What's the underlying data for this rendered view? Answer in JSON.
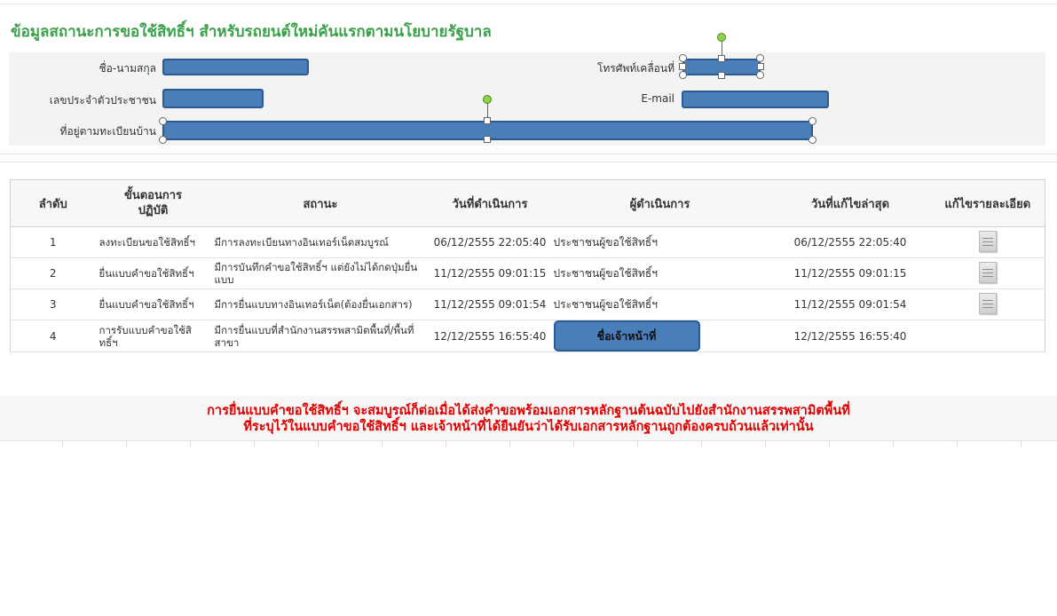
{
  "form": {
    "title": "ข้อมูลสถานะการขอใช้สิทธิ์ฯ สำหรับรถยนต์ใหม่คันแรกตามนโยบายรัฐบาล",
    "label_name": "ชื่อ-นามสกุล",
    "label_id": "เลขประจำตัวประชาชน",
    "label_address": "ที่อยู่ตามทะเบียนบ้าน",
    "label_mobile": "โทรศัพท์เคลื่อนที่",
    "label_email": "E-mail"
  },
  "table": {
    "headers": {
      "no": "ลำดับ",
      "step": "ขั้นตอนการปฏิบัติ",
      "status": "สถานะ",
      "date": "วันที่ดำเนินการ",
      "operator": "ผู้ดำเนินการ",
      "last_edit": "วันที่แก้ไขล่าสุด",
      "edit_detail": "แก้ไขรายละเอียด"
    },
    "rows": [
      {
        "no": "1",
        "step": "ลงทะเบียนขอใช้สิทธิ์ฯ",
        "status": "มีการลงทะเบียนทางอินเทอร์เน็ตสมบูรณ์",
        "date": "06/12/2555 22:05:40",
        "operator": "ประชาชนผู้ขอใช้สิทธิ์ฯ",
        "last_edit": "06/12/2555 22:05:40"
      },
      {
        "no": "2",
        "step": "ยื่นแบบคำขอใช้สิทธิ์ฯ",
        "status": "มีการบันทึกคำขอใช้สิทธิ์ฯ แต่ยังไม่ได้กดปุ่มยื่นแบบ",
        "date": "11/12/2555 09:01:15",
        "operator": "ประชาชนผู้ขอใช้สิทธิ์ฯ",
        "last_edit": "11/12/2555 09:01:15"
      },
      {
        "no": "3",
        "step": "ยื่นแบบคำขอใช้สิทธิ์ฯ",
        "status": "มีการยื่นแบบทางอินเทอร์เน็ต(ต้องยื่นเอกสาร)",
        "date": "11/12/2555 09:01:54",
        "operator": "ประชาชนผู้ขอใช้สิทธิ์ฯ",
        "last_edit": "11/12/2555 09:01:54"
      },
      {
        "no": "4",
        "step": "การรับแบบคำขอใช้สิทธิ์ฯ",
        "status": "มีการยื่นแบบที่สำนักงานสรรพสามิตพื้นที่/พื้นที่สาขา",
        "date": "12/12/2555 16:55:40",
        "operator": "ชื่อเจ้าหน้าที่",
        "last_edit": "12/12/2555 16:55:40"
      }
    ]
  },
  "notice": {
    "line1": "การยื่นแบบคำขอใช้สิทธิ์ฯ จะสมบูรณ์ก็ต่อเมื่อได้ส่งคำขอพร้อมเอกสารหลักฐานต้นฉบับไปยังสำนักงานสรรพสามิตพื้นที่",
    "line2": "ที่ระบุไว้ในแบบคำขอใช้สิทธิ์ฯ และเจ้าหน้าที่ได้ยืนยันว่าได้รับเอกสารหลักฐานถูกต้องครบถ้วนแล้วเท่านั้น"
  },
  "colors": {
    "title_green": "#3aa04a",
    "field_blue": "#4a7ebb",
    "field_border": "#2b5a8e",
    "notice_red": "#e00000",
    "rotation_handle_green": "#8cd34a"
  },
  "icons": {
    "edit_detail": "document-icon",
    "handle": "resize-handle",
    "rotate": "rotation-handle"
  }
}
